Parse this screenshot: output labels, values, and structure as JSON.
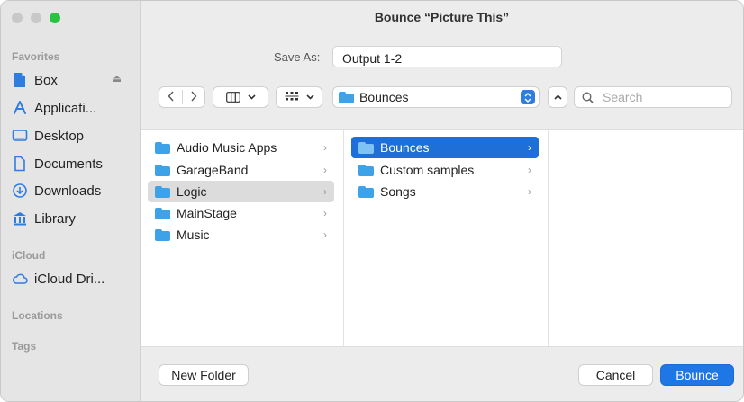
{
  "window": {
    "title": "Bounce “Picture This”"
  },
  "sidebar": {
    "favorites_header": "Favorites",
    "favorites": [
      {
        "label": "Box",
        "icon": "document-icon"
      },
      {
        "label": "Applicati...",
        "icon": "applications-icon"
      },
      {
        "label": "Desktop",
        "icon": "desktop-icon"
      },
      {
        "label": "Documents",
        "icon": "documents-icon"
      },
      {
        "label": "Downloads",
        "icon": "downloads-icon"
      },
      {
        "label": "Library",
        "icon": "library-icon"
      }
    ],
    "icloud_header": "iCloud",
    "icloud": [
      {
        "label": "iCloud Dri...",
        "icon": "cloud-icon"
      }
    ],
    "locations_header": "Locations",
    "tags_header": "Tags"
  },
  "save_as": {
    "label": "Save As:",
    "value": "Output 1-2"
  },
  "toolbar": {
    "location": "Bounces",
    "search_placeholder": "Search"
  },
  "browser": {
    "column1": [
      {
        "name": "Audio Music Apps",
        "selected": false
      },
      {
        "name": "GarageBand",
        "selected": false
      },
      {
        "name": "Logic",
        "selected": true
      },
      {
        "name": "MainStage",
        "selected": false
      },
      {
        "name": "Music",
        "selected": false
      }
    ],
    "column2": [
      {
        "name": "Bounces",
        "selected": true
      },
      {
        "name": "Custom samples",
        "selected": false
      },
      {
        "name": "Songs",
        "selected": false
      }
    ]
  },
  "buttons": {
    "new_folder": "New Folder",
    "cancel": "Cancel",
    "bounce": "Bounce"
  },
  "colors": {
    "accent": "#1f77e6",
    "folder": "#3ea2e8",
    "selection_gray": "#dcdcdc"
  }
}
